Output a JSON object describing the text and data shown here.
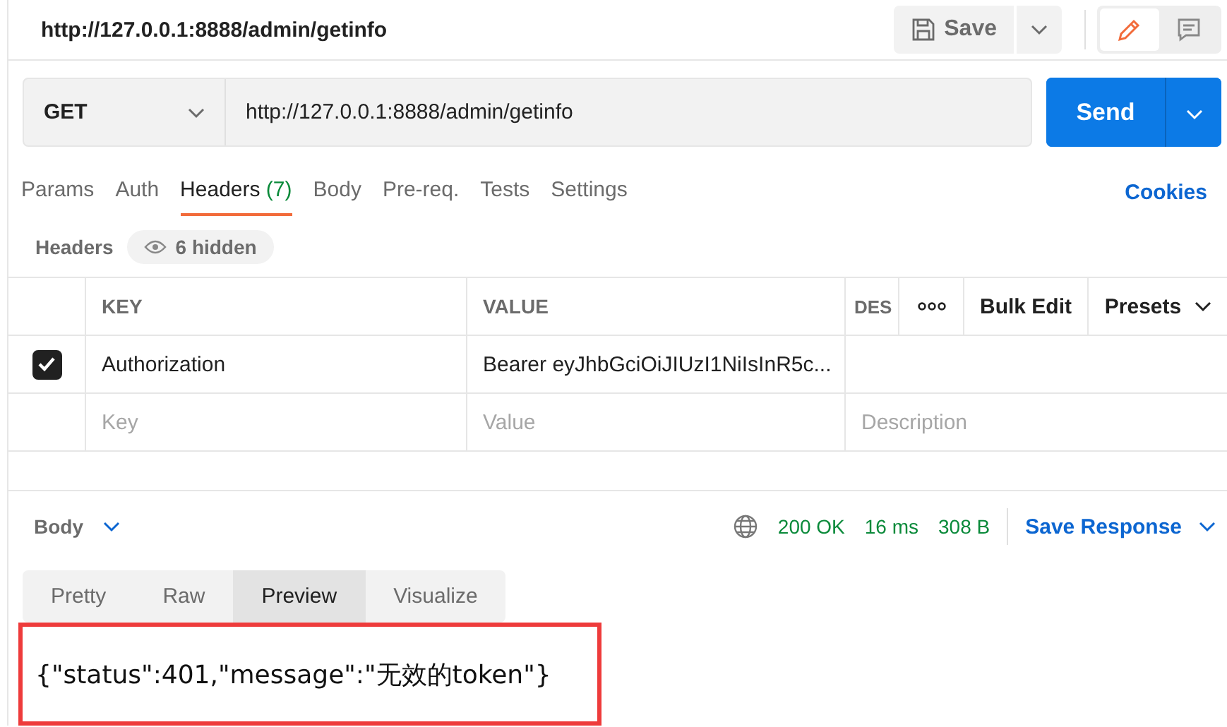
{
  "request": {
    "title": "http://127.0.0.1:8888/admin/getinfo",
    "save_label": "Save",
    "modes": [
      {
        "kind": "edit",
        "selected": true
      },
      {
        "kind": "comment",
        "selected": false
      }
    ],
    "method": "GET",
    "url": "http://127.0.0.1:8888/admin/getinfo",
    "send_label": "Send"
  },
  "tabs": [
    {
      "label": "Params",
      "selected": false
    },
    {
      "label": "Auth",
      "selected": false
    },
    {
      "label": "Headers",
      "count": "(7)",
      "selected": true
    },
    {
      "label": "Body",
      "selected": false
    },
    {
      "label": "Pre-req.",
      "selected": false
    },
    {
      "label": "Tests",
      "selected": false
    },
    {
      "label": "Settings",
      "selected": false
    }
  ],
  "cookies": "Cookies",
  "headers": {
    "title": "Headers",
    "hidden": "6 hidden",
    "columns": [
      "KEY",
      "VALUE",
      "DES"
    ],
    "bulk_edit": "Bulk Edit",
    "presets": "Presets",
    "rows": [
      {
        "checked": true,
        "key": "Authorization",
        "value": "Bearer eyJhbGciOiJIUzI1NiIsInR5c..."
      }
    ],
    "placeholder_row": {
      "key": "Key",
      "value": "Value",
      "description": "Description"
    }
  },
  "response": {
    "body_label": "Body",
    "status": "200 OK",
    "time": "16 ms",
    "size": "308 B",
    "save_response": "Save Response",
    "tabs": [
      {
        "label": "Pretty",
        "selected": false
      },
      {
        "label": "Raw",
        "selected": false
      },
      {
        "label": "Preview",
        "selected": true
      },
      {
        "label": "Visualize",
        "selected": false
      }
    ],
    "preview_text": "{\"status\":401,\"message\":\"无效的token\"}"
  }
}
